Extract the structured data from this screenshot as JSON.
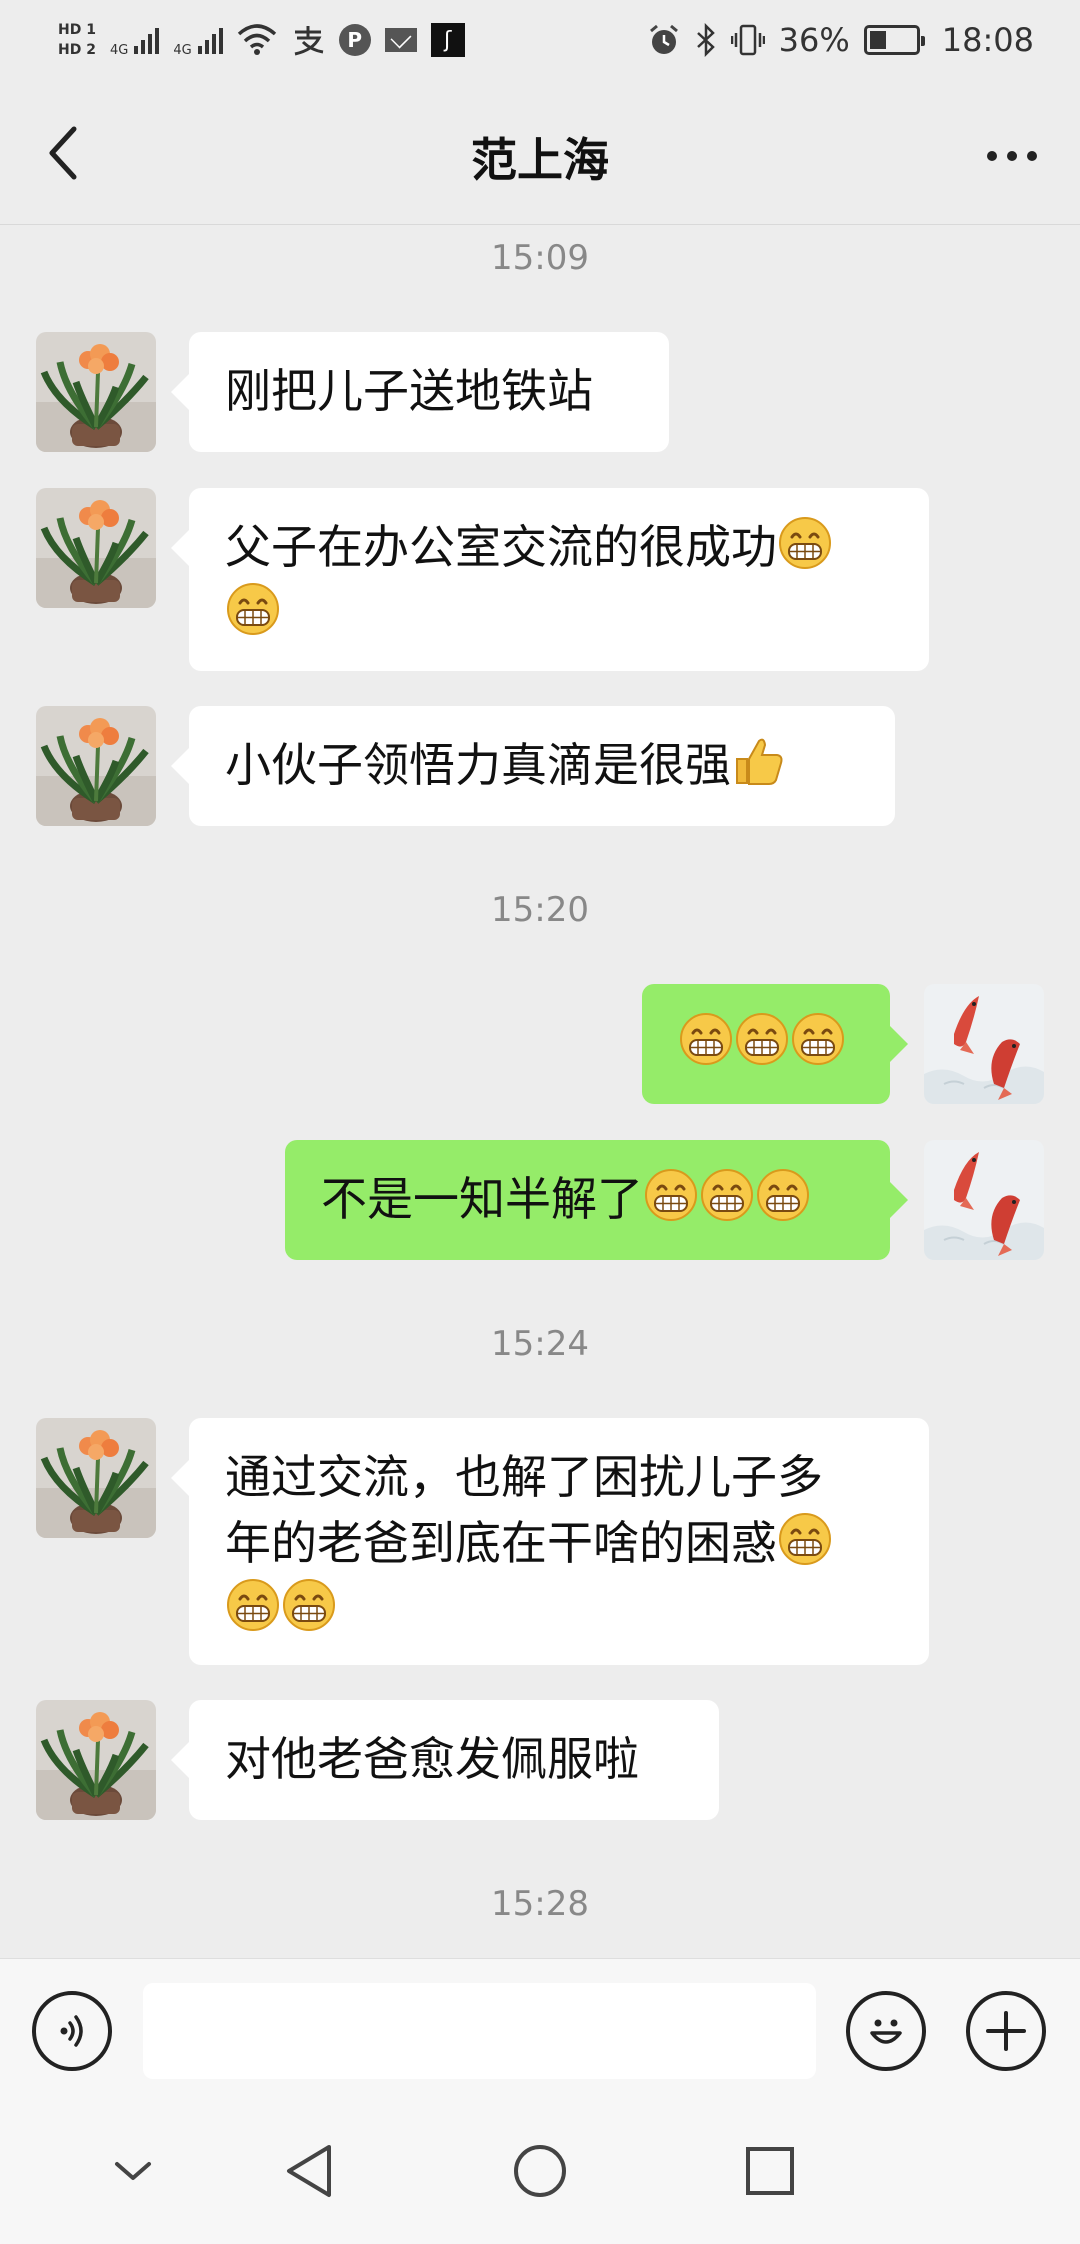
{
  "status_bar": {
    "hd1": "HD 1",
    "hd2": "HD 2",
    "net1": "4G",
    "net2": "4G",
    "battery_percent": "36%",
    "battery_level": 0.36,
    "time": "18:08",
    "icons": [
      "signal-icon",
      "signal-icon",
      "wifi-icon",
      "alipay-icon",
      "p-icon",
      "mail-icon",
      "app-icon",
      "alarm-icon",
      "bluetooth-icon",
      "vibrate-icon",
      "battery-icon"
    ]
  },
  "header": {
    "title": "范上海"
  },
  "chat": {
    "timestamps": [
      "15:09",
      "15:20",
      "15:24",
      "15:28"
    ],
    "messages": [
      {
        "side": "in",
        "line1": "刚把儿子送地铁站"
      },
      {
        "side": "in",
        "line1": "父子在办公室交流的很成功",
        "line1_emoji_count": 1,
        "line2_emoji_count": 1
      },
      {
        "side": "in",
        "line1": "小伙子领悟力真滴是很强",
        "line1_emoji": "thumbs-up"
      },
      {
        "side": "out",
        "line1": "",
        "line1_emoji_count": 3
      },
      {
        "side": "out",
        "line1": "不是一知半解了",
        "line1_emoji_count": 3
      },
      {
        "side": "in",
        "line1": "通过交流，也解了困扰儿子多",
        "line2": "年的老爸到底在干啥的困惑",
        "line2_emoji_count": 1,
        "line3_emoji_count": 2
      },
      {
        "side": "in",
        "line1": "对他老爸愈发佩服啦"
      }
    ]
  },
  "input_bar": {
    "value": "",
    "icons": [
      "voice-icon",
      "emoji-icon",
      "plus-icon"
    ]
  },
  "nav_bar": {
    "icons": [
      "chevron-down-icon",
      "back-triangle-icon",
      "home-circle-icon",
      "recents-square-icon"
    ]
  },
  "colors": {
    "background": "#ededed",
    "incoming_bubble": "#ffffff",
    "outgoing_bubble": "#95ec69"
  }
}
